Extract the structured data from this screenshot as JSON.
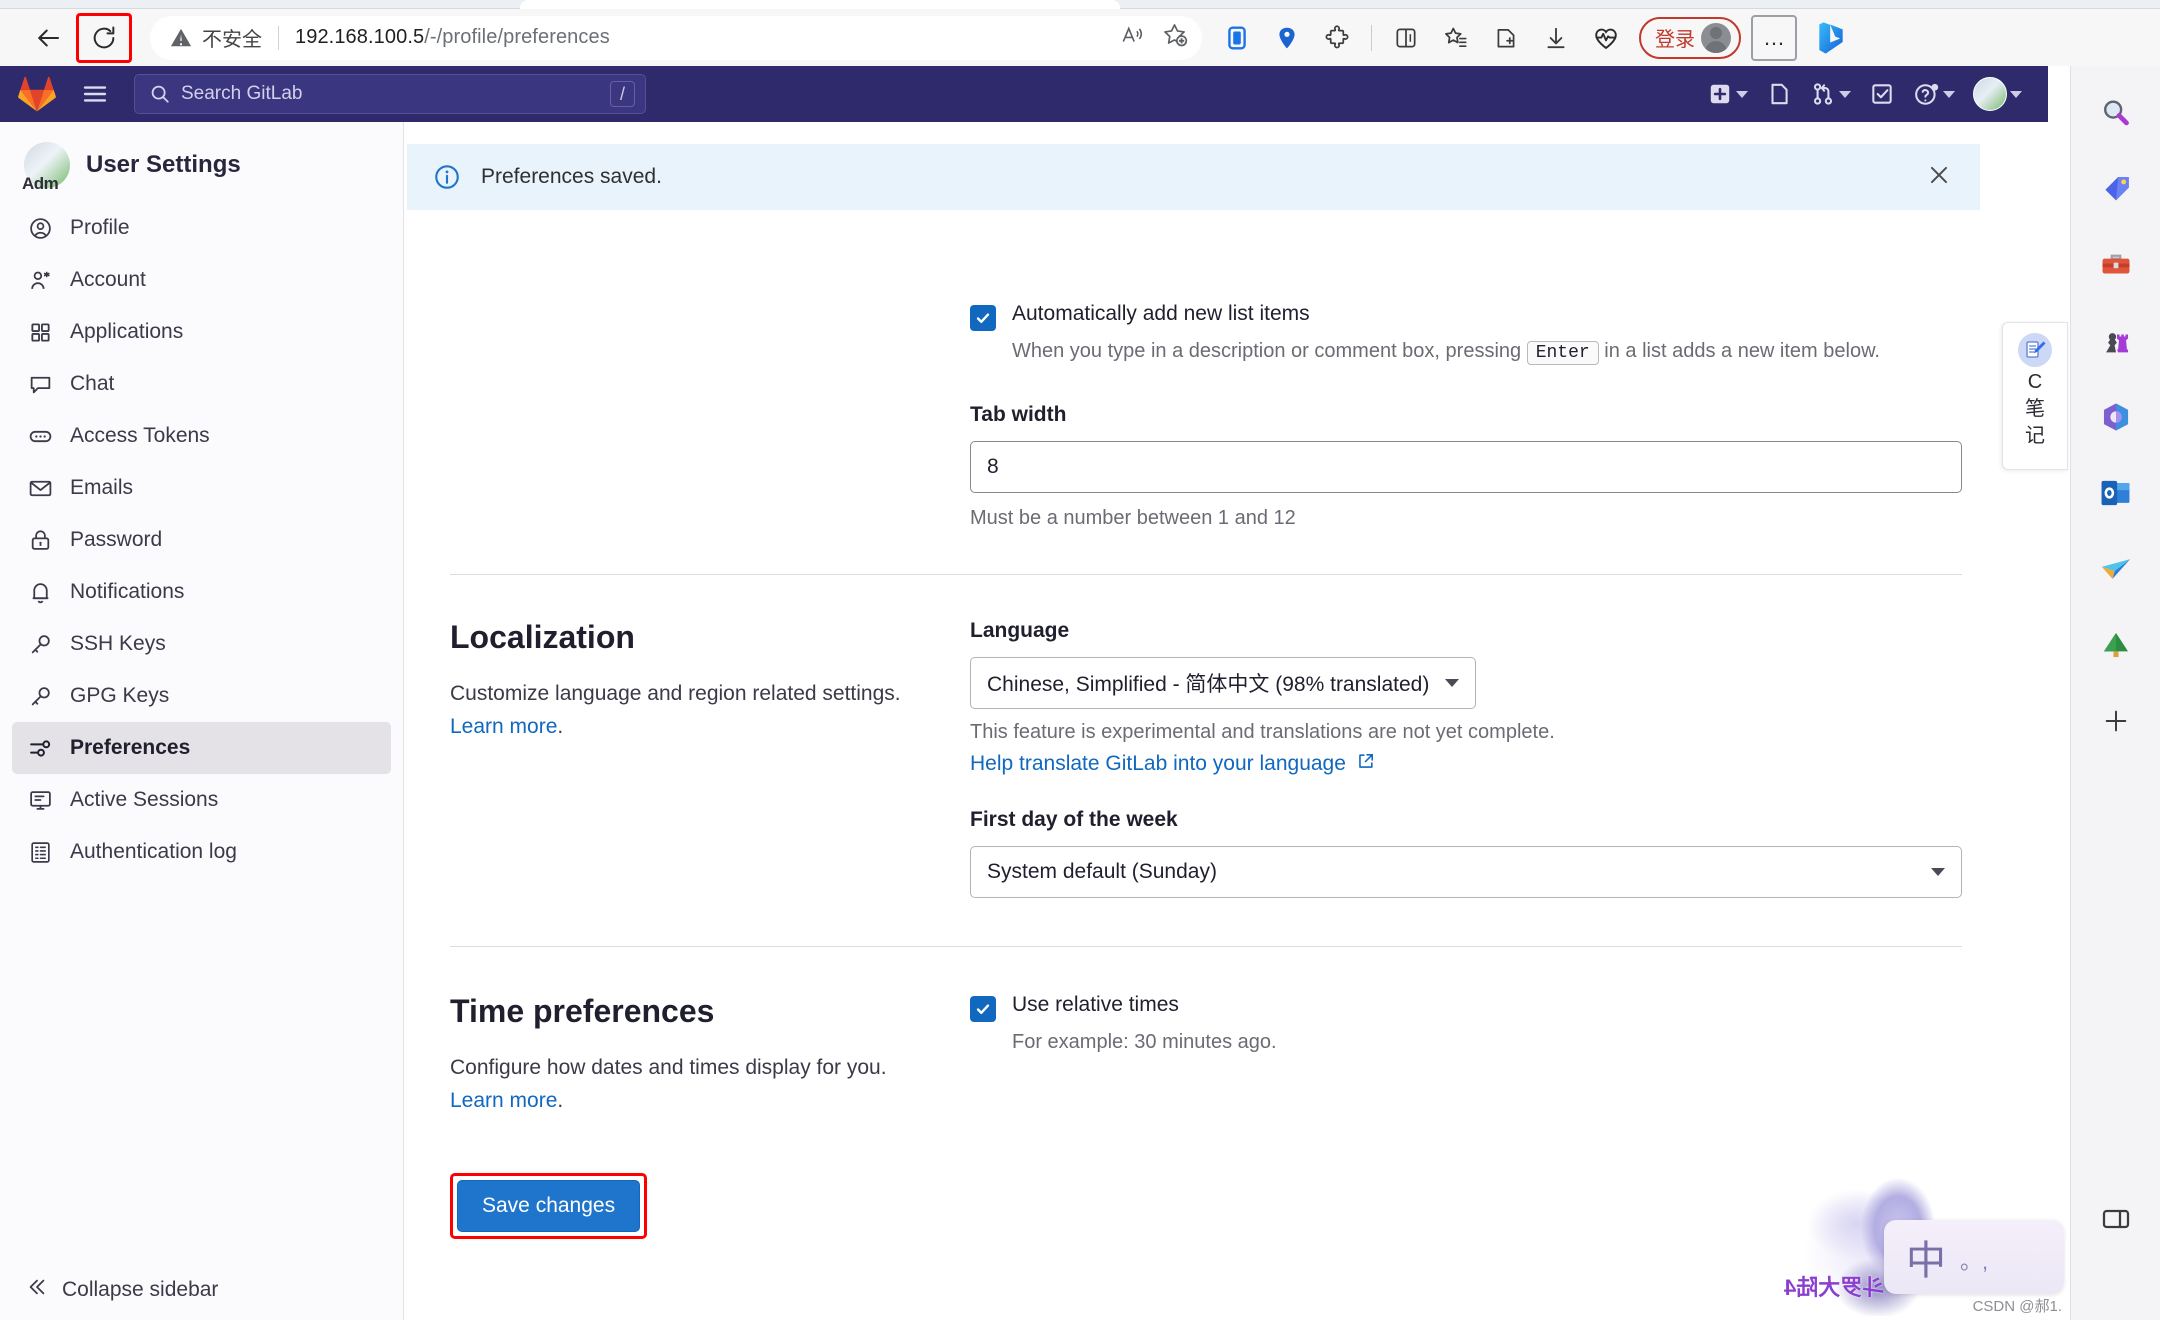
{
  "browser": {
    "back_label": "Back",
    "reload_label": "Reload",
    "security_text": "不安全",
    "url_host": "192.168.100.5",
    "url_path": "/-/profile/preferences",
    "read_aloud_icon": "read-aloud-icon",
    "favorite_icon": "add-favorite-icon",
    "signin_label": "登录",
    "more_label": "…",
    "toolbar_icons": [
      "split-screen-app-icon",
      "drop-pin-icon",
      "extensions-puzzle-icon",
      "browser-essentials-icon",
      "collections-icon",
      "favorites-list-icon",
      "downloads-icon",
      "performance-heart-icon"
    ]
  },
  "gitlab": {
    "logo_icon": "gitlab-logo-icon",
    "menu_icon": "hamburger-menu-icon",
    "search": {
      "placeholder": "Search GitLab",
      "shortcut": "/"
    },
    "header_actions": [
      "new-item-plus-icon",
      "issues-icon",
      "merge-requests-icon",
      "todos-checkbox-icon",
      "help-question-icon",
      "user-avatar"
    ]
  },
  "sidebar": {
    "title": "User Settings",
    "avatar_label": "Adm",
    "items": [
      {
        "label": "Profile",
        "icon": "user-circle-icon",
        "active": false
      },
      {
        "label": "Account",
        "icon": "user-gear-icon",
        "active": false
      },
      {
        "label": "Applications",
        "icon": "grid-apps-icon",
        "active": false
      },
      {
        "label": "Chat",
        "icon": "comment-icon",
        "active": false
      },
      {
        "label": "Access Tokens",
        "icon": "token-ellipsis-icon",
        "active": false
      },
      {
        "label": "Emails",
        "icon": "envelope-icon",
        "active": false
      },
      {
        "label": "Password",
        "icon": "lock-icon",
        "active": false
      },
      {
        "label": "Notifications",
        "icon": "bell-icon",
        "active": false
      },
      {
        "label": "SSH Keys",
        "icon": "key-icon",
        "active": false
      },
      {
        "label": "GPG Keys",
        "icon": "key-icon",
        "active": false
      },
      {
        "label": "Preferences",
        "icon": "sliders-icon",
        "active": true
      },
      {
        "label": "Active Sessions",
        "icon": "monitor-icon",
        "active": false
      },
      {
        "label": "Authentication log",
        "icon": "log-grid-icon",
        "active": false
      }
    ],
    "collapse_label": "Collapse sidebar",
    "collapse_icon": "chevron-double-left-icon"
  },
  "alert": {
    "icon": "info-circle-icon",
    "message": "Preferences saved.",
    "close_icon": "close-icon"
  },
  "behavior": {
    "auto_list_label": "Automatically add new list items",
    "auto_list_desc_before": "When you type in a description or comment box, pressing",
    "auto_list_kbd": "Enter",
    "auto_list_desc_after": "in a list adds a new item below.",
    "tab_width_label": "Tab width",
    "tab_width_value": "8",
    "tab_width_hint": "Must be a number between 1 and 12"
  },
  "localization": {
    "title": "Localization",
    "desc_before": "Customize language and region related settings.",
    "desc_link": "Learn more",
    "desc_after": ".",
    "language_label": "Language",
    "language_value": "Chinese, Simplified - 简体中文 (98% translated)",
    "language_hint": "This feature is experimental and translations are not yet complete.",
    "translate_link": "Help translate GitLab into your language",
    "external_icon": "external-link-icon",
    "first_day_label": "First day of the week",
    "first_day_value": "System default (Sunday)"
  },
  "time_preferences": {
    "title": "Time preferences",
    "desc_before": "Configure how dates and times display for you.",
    "desc_link": "Learn more",
    "desc_after": ".",
    "relative_times_label": "Use relative times",
    "relative_times_desc": "For example: 30 minutes ago.",
    "relative_times_checked": true
  },
  "save": {
    "label": "Save changes",
    "highlight_color": "#ff0000",
    "button_color": "#1f75cb"
  },
  "note_widget": {
    "icon": "note-pen-icon",
    "line1": "C",
    "line2": "笔",
    "line3": "记"
  },
  "edge_sidebar": {
    "icons": [
      "search-magnifier-icon",
      "shopping-tag-icon",
      "tools-toolbox-icon",
      "games-chess-icon",
      "office-icon",
      "outlook-icon",
      "paper-plane-icon",
      "tree-icon",
      "add-plus-icon"
    ],
    "bottom_icon": "split-pane-icon"
  },
  "ime": {
    "mode": "中",
    "dots": "。,",
    "title": "斗罗大陆4",
    "watermark": "CSDN @郝1."
  },
  "colors": {
    "gitlab_header": "#2f2a6b",
    "accent_blue": "#1f75cb",
    "link_blue": "#1068bf",
    "alert_bg": "#e9f3fc",
    "highlight_red": "#ff0000"
  }
}
